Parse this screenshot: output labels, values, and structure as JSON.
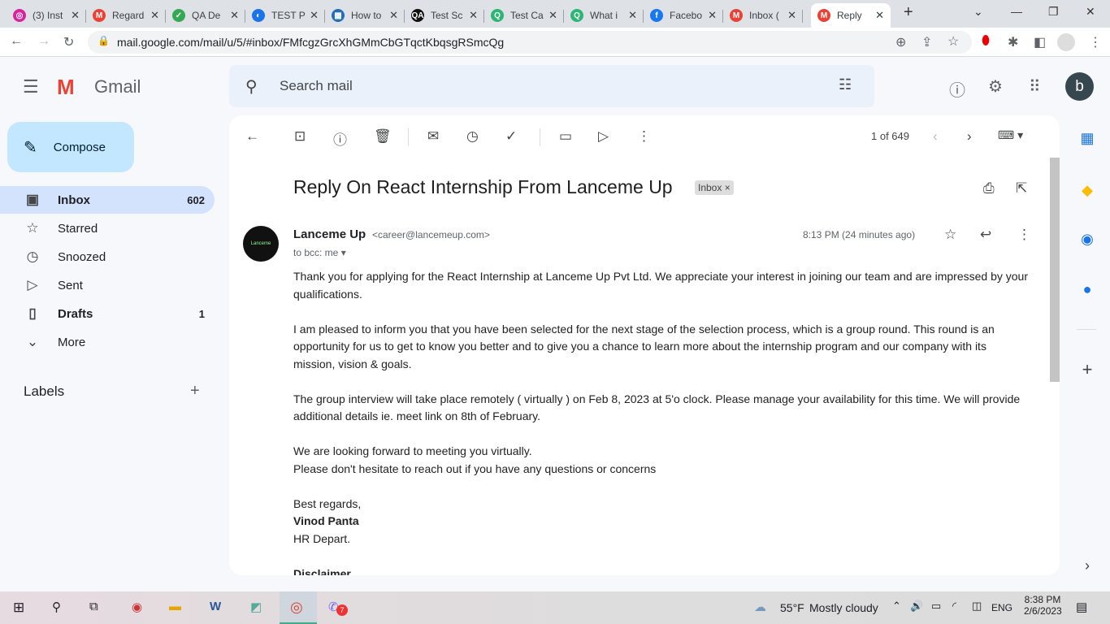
{
  "browser": {
    "tabs": [
      {
        "label": "(3) Inst",
        "color": "#d6249f",
        "glyph": "◎"
      },
      {
        "label": "Regard",
        "color": "#ea4335",
        "glyph": "M"
      },
      {
        "label": "QA De",
        "color": "#34a853",
        "glyph": "✓"
      },
      {
        "label": "TEST P",
        "color": "#1a73e8",
        "glyph": "◐"
      },
      {
        "label": "How to",
        "color": "#1f6fb2",
        "glyph": "▦"
      },
      {
        "label": "Test Sc",
        "color": "#111111",
        "glyph": "QA"
      },
      {
        "label": "Test Ca",
        "color": "#2bb673",
        "glyph": "Q"
      },
      {
        "label": "What i",
        "color": "#2bb673",
        "glyph": "Q"
      },
      {
        "label": "Facebo",
        "color": "#1877f2",
        "glyph": "f"
      },
      {
        "label": "Inbox (",
        "color": "#ea4335",
        "glyph": "M"
      },
      {
        "label": "Reply",
        "color": "#ea4335",
        "glyph": "M"
      }
    ],
    "url": "mail.google.com/mail/u/5/#inbox/FMfcgzGrcXhGMmCbGTqctKbqsgRSmcQg"
  },
  "gmail": {
    "logo": "Gmail",
    "search_placeholder": "Search mail",
    "avatar": "b",
    "compose": "Compose",
    "nav": [
      {
        "label": "Inbox",
        "count": "602",
        "icon": "inbox-icon",
        "glyph": "▣"
      },
      {
        "label": "Starred",
        "count": "",
        "icon": "star-icon",
        "glyph": "☆"
      },
      {
        "label": "Snoozed",
        "count": "",
        "icon": "clock-icon",
        "glyph": "◷"
      },
      {
        "label": "Sent",
        "count": "",
        "icon": "send-icon",
        "glyph": "▷"
      },
      {
        "label": "Drafts",
        "count": "1",
        "icon": "draft-icon",
        "glyph": "▯"
      },
      {
        "label": "More",
        "count": "",
        "icon": "chevron-down-icon",
        "glyph": "⌄"
      }
    ],
    "labels_heading": "Labels",
    "pager": "1 of 649",
    "subject": "Reply On React Internship From Lanceme Up",
    "label_chip": "Inbox",
    "sender_name": "Lanceme Up",
    "sender_email": "<career@lancemeup.com>",
    "sender_avatar_text": "Lanceme",
    "time": "8:13 PM (24 minutes ago)",
    "to": "to bcc: me",
    "body": [
      "Thank you for applying for the React Internship at Lanceme Up Pvt Ltd. We appreciate your interest in joining our team and are impressed by your qualifications.",
      "I am pleased to inform you that you have been selected for the next stage of the selection process, which is a group round. This round is an opportunity for us to get to know you better and to give you a chance to learn more about the internship program and our company with its mission, vision & goals.",
      "The group interview will take place remotely ( virtually ) on Feb 8, 2023  at 5'o clock. Please manage your availability for this time. We will provide additional details ie. meet link on 8th of February."
    ],
    "closing1": "We are looking forward to meeting you virtually.",
    "closing2": "Please don't hesitate to reach out if you have any questions or concerns",
    "regards": "Best regards,",
    "signer": "Vinod Panta",
    "dept": "HR Depart.",
    "disclaimer": "Disclaimer"
  },
  "taskbar": {
    "weather_temp": "55°F",
    "weather_desc": "Mostly cloudy",
    "lang": "ENG",
    "time": "8:38 PM",
    "date": "2/6/2023",
    "viber_badge": "7"
  }
}
